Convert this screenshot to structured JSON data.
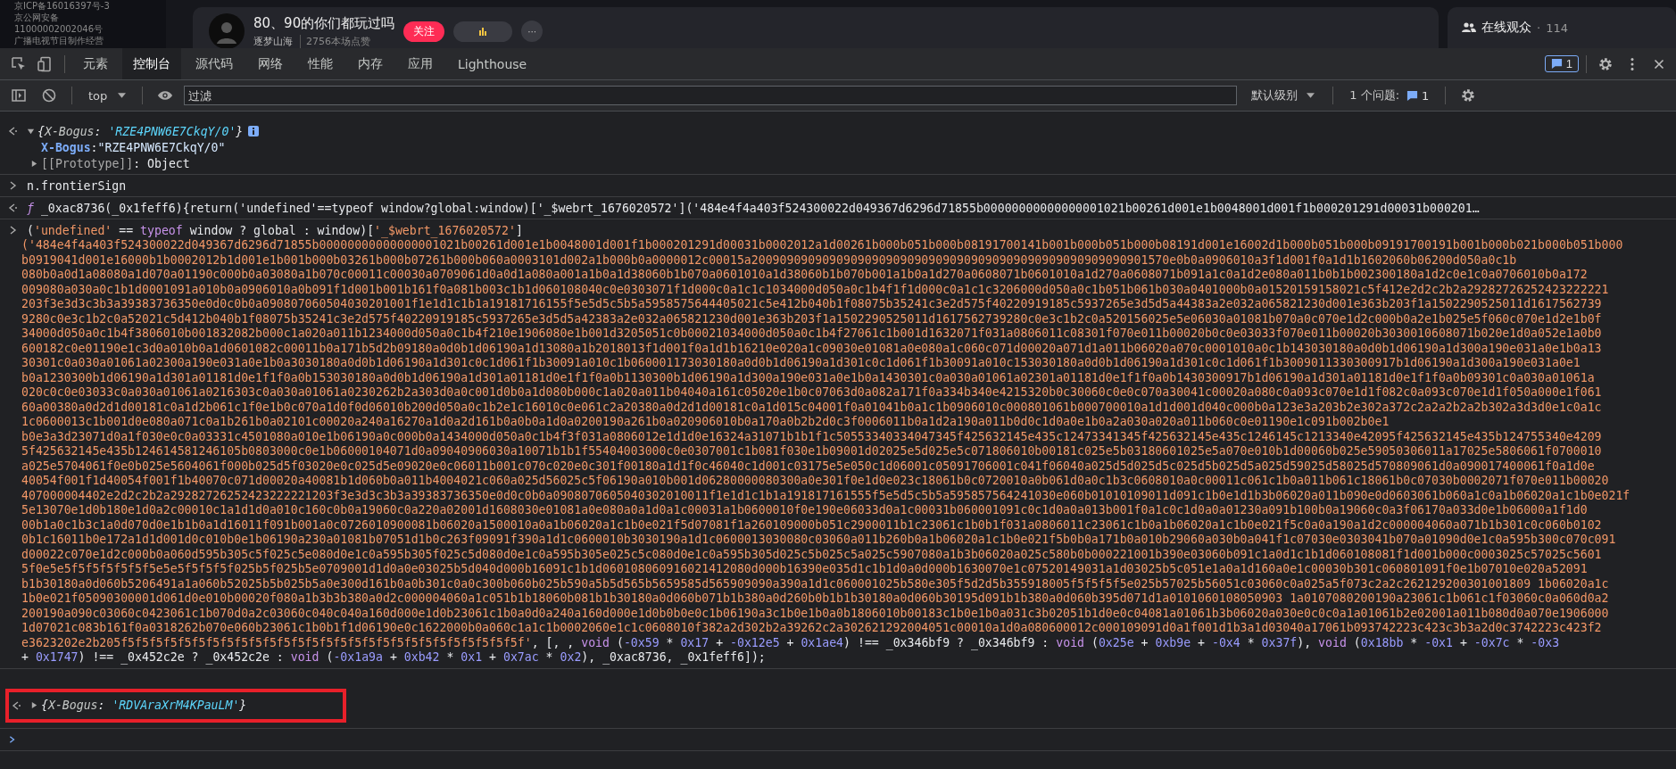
{
  "page": {
    "notices": [
      "京ICP备16016397号-3",
      "京公网安备",
      "11000002002046号",
      "广播电视节目制作经营"
    ],
    "stream": {
      "title": "80、90的你们都玩过吗",
      "streamer": "逐梦山海",
      "likes": "2756本场点赞",
      "follow": "关注",
      "more": "···"
    },
    "audience": {
      "label": "在线观众",
      "separator": "·",
      "count": "114"
    }
  },
  "devtools": {
    "tabs": [
      {
        "label": "元素",
        "selected": false
      },
      {
        "label": "控制台",
        "selected": true
      },
      {
        "label": "源代码",
        "selected": false
      },
      {
        "label": "网络",
        "selected": false
      },
      {
        "label": "性能",
        "selected": false
      },
      {
        "label": "内存",
        "selected": false
      },
      {
        "label": "应用",
        "selected": false
      },
      {
        "label": "Lighthouse",
        "selected": false
      }
    ],
    "message_count": "1",
    "toolbar": {
      "context": "top",
      "filter_placeholder": "过滤",
      "level": "默认级别",
      "issues_label": "1 个问题:",
      "issues_count": "1"
    }
  },
  "console": [
    {
      "kind": "object",
      "expanded": true,
      "summary": [
        {
          "kind": "plain",
          "text": "{"
        },
        {
          "kind": "key",
          "text": "X-Bogus"
        },
        {
          "kind": "plain",
          "text": ": "
        },
        {
          "kind": "val",
          "text": "'RZE4PNW6E7CkqY/0'"
        },
        {
          "kind": "plain",
          "text": "}"
        }
      ],
      "props": [
        {
          "key": "X-Bogus",
          "colon": ":",
          "value": "\"RZE4PNW6E7CkqY/0\""
        }
      ],
      "proto": {
        "key": "[[Prototype]]",
        "colon": ":",
        "value": "Object",
        "expanded": false
      }
    },
    {
      "kind": "input",
      "text": "n.frontierSign"
    },
    {
      "kind": "function",
      "tokens": [
        {
          "kind": "fn",
          "text": "ƒ"
        },
        {
          "kind": "plain",
          "text": " _0xac8736(_0x1feff6){return('undefined'==typeof window?global:window)['_$webrt_1676020572']('484e4f4a403f524300022d049367d6296d71855b00000000000000001021b00261d001e1b0048001d001f1b000201291d00031b000201…"
        }
      ]
    },
    {
      "kind": "expression",
      "header": [
        {
          "kind": "plain",
          "text": "("
        },
        {
          "kind": "str",
          "text": "'undefined'"
        },
        {
          "kind": "plain",
          "text": " == "
        },
        {
          "kind": "kw",
          "text": "typeof"
        },
        {
          "kind": "plain",
          "text": " window ? global : window)["
        },
        {
          "kind": "str",
          "text": "'_$webrt_1676020572'"
        },
        {
          "kind": "plain",
          "text": "]"
        }
      ],
      "lines": [
        "('484e4f4a403f524300022d049367d6296d71855b00000000000000001021b00261d001e1b0048001d001f1b000201291d00031b0002012a1d00261b000b051b000b08191700141b001b000b051b000b08191d001e16002d1b000b051b000b09191700191b001b000b021b000b051b000",
        "b0919041d001e16000b1b0002012b1d001e1b001b000b03261b000b07261b000b060a0003101d002a1b000b0a0000012c00015a20090909090909090909090909090909090909090909090909090901570e0b0a0906010a3f1d001f0a1d1b1602060b06200d050a0c1b",
        "080b0a0d1a08080a1d070a01190c000b0a03080a1b070c00011c00030a0709061d0a0d1a080a001a1b0a1d38060b1b070a0601010a1d38060b1b070b001a1b0a1d270a0608071b0601010a1d270a0608071b091a1c0a1d2e080a011b0b1b002300180a1d2c0e1c0a0706010b0a172",
        "009080a030a0c1b1d0001091a010b0a0906010a0b091f1d001b001b161f0a081b003c1b1d060108040c0e0303071f1d000c0a1c1c1034000d050a0c1b4f1f1d000c0a1c1c3206000d050a0c1b051b061b030a0401000b0a01520159158021c5f412e2d2c2b2a29282726252423222221",
        "203f3e3d3c3b3a39383736350e0d0c0b0a090807060504030201001f1e1d1c1b1a19181716155f5e5d5c5b5a5958575644405021c5e412b040b1f08075b35241c3e2d575f40220919185c5937265e3d5d5a44383a2e032a065821230d001e363b203f1a1502290525011d1617562739",
        "9280c0e3c1b2c0a52021c5d412b040b1f08075b35241c3e2d575f40220919185c5937265e3d5d5a42383a2e032a065821230d001e363b203f1a1502290525011d1617562739280c0e3c1b2c0a520156025e5e06030a01081b070a0c070e1d2c000b0a2e1b025e5f060c070e1d2e1b0f",
        "34000d050a0c1b4f3806010b001832082b000c1a020a011b1234000d050a0c1b4f210e1906080e1b001d3205051c0b00021034000d050a0c1b4f27061c1b001d1632071f031a0806011c08301f070e011b00020b0c0e03033f070e011b00020b3030010608071b020e1d0a052e1a0b0",
        "600182c0e01190e1c3d0a010b0a1d0601082c00011b0a171b5d2b09180a0d0b1d06190a1d13080a1b2018013f1d001f0a1d1b16210e020a1c09030e01081a0e080a1c060c071d00020a071d1a011b06020a070c0001010a0c1b143030180a0d0b1d06190a1d300a190e031a0e1b0a13",
        "30301c0a030a01061a02300a190e031a0e1b0a3030180a0d0b1d06190a1d301c0c1d061f1b30091a010c1b060001173030180a0d0b1d06190a1d301c0c1d061f1b30091a010c153030180a0d0b1d06190a1d301c0c1d061f1b3009011330300917b1d06190a1d300a190e031a0e1",
        "b0a1230300b1d06190a1d301a01181d0e1f1f0a0b153030180a0d0b1d06190a1d301a01181d0e1f1f0a0b1130300b1d06190a1d300a190e031a0e1b0a1430301c0a030a01061a02301a01181d0e1f1f0a0b1430300917b1d06190a1d301a01181d0e1f1f0a0b09301c0a030a01061a",
        "020c0c0e03033c0a030a01061a0216303c0a030a01061a0230262b2a303d0a0c001d0b0a1d080b000c1a020a011b04040a161c05020e1b0c07063d0a082a171f0a334b340e4215320b0c30060c0e0c070a30041c00020a080c0a093c070e1d1f082c0a093c070e1d1f050a000e1f061",
        "60a00380a0d2d1d00181c0a1d2b061c1f0e1b0c070a1d0f0d06010b200d050a0c1b2e1c16010c0e061c2a20380a0d2d1d00181c0a1d015c04001f0a01041b0a1c1b0906010c000801061b000700010a1d1d001d040c000b0a123e3a203b2e302a372c2a2a2b2a2b302a3d3d0e1c0a1c",
        "1c0600013c1b001d0e080a071c0a1b261b0a02101c00020a240a16270a1d0a2d161b0a0b0a1d0a0200190a261b0a020906010b0a170a0b2b2d0c3f0006011b0a1d2a190a011b0d0c1d0a0e1b0a2a030a020a011b060c0e01190e1c091b002b0e1",
        "b0e3a3d23071d0a1f030e0c0a03331c4501080a010e1b06190a0c000b0a1434000d050a0c1b4f3f031a0806012e1d1d0e16324a31071b1b1f1c50553340334047345f425632145e435c12473341345f425632145e435c1246145c1213340e42095f425632145e435b124755340e4209",
        "5f425632145e435b124614581246105b0803000c0e1b06000104071d0a09040906030a10071b1b1f55404003000c0e0307001c1b081f030e1b09001d02025e5d025e5c071806010b00181c025e5b03180601025e5a070e010b1d00060b025e59050306011a17025e5806061f0700010",
        "a025e5704061f0e0b025e5604061f000b025d5f03020e0c025d5e09020e0c06011b001c070c020e0c301f00180a1d1f0c46040c1d001c03175e5e050c1d06001c05091706001c041f06040a025d5d025d5c025d5b025d5a025d59025d58025d570809061d0a090017400061f0a1d0e",
        "40054f001f1d40054f001f1b40070c071d00020a40081b1d060b0a011b4004021c060a025d56025c5f06190a010b001d06280000080300a0e301f0e1d0e023c18061b0c0720010a0b061d0a0c1b3c0608010a0c00011c061c1b0a011b061c18061b0c07030b0002071f070e011b00020",
        "407000004402e2d2c2b2a29282726252423222221203f3e3d3c3b3a39383736350e0d0c0b0a0908070605040302010011f1e1d1c1b1a191817161555f5e5d5c5b5a595857564241030e060b01010109011d091c1b0e1d1b3b06020a011b090e0d0603061b060a1c0a1b06020a1c1b0e021f",
        "5e13070e1d0b180e1d0a2c00010c1a1d1d0a010c160c0b0a19060c0a220a02001d1608030e01081a0e080a0a1d0a1c00031a1b0600010f0e190e06033d0a1c00031b060001091c0c1d0a0a013b001f0a1c0c1d0a0a01230a091b100b0a19060c0a3f06170a033d0e1b06000a1f1d0",
        "00b1a0c1b3c1a0d070d0e1b1b0a1d16011f091b001a0c0726010900081b06020a1500010a0a1b06020a1c1b0e021f5d07081f1a260109000b051c2900011b1c23061c1b0b1f031a0806011c23061c1b0a1b06020a1c1b0e021f5c0a0a190a1d2c000004060a071b1b301c0c060b0102",
        "0b1c16011b0e172a1d1d001d0c010b0e1b06190a230a01081b07051d1b0c263f09091f390a1d1c0600010b3030190a1d1c0600013030080c03060a011b260b0a1b06020a1c1b0e021f5b0b0a171b0a010b29060a030b0a041f1c07030e0303041b070a01090d0e1c0a595b300c070c091",
        "d00022c070e1d2c000b0a060d595b305c5f025c5e080d0e1c0a595b305f025c5d080d0e1c0a595b305e025c5c080d0e1c0a595b305d025c5b025c5a025c5907080a1b3b06020a025c580b0b000221001b390e03060b091c1a0d1c1b1d060108081f1d001b000c0003025c57025c5601",
        "5f0e5e5f5f5f5f5f5f5e5e5f5f5f5f025b5f025b5e0709001d1d0a0e03025b5d040d000b16091c1b1d060108060916021412080d000b16390e035d1c1b1d0a0d000b1630070e1c07520149031a1d03025b5c051e1a0a1d160a0e1c00030b301c060801091f0e1b07010e020a52091",
        "b1b30180a0d060b5206491a1a060b52025b5b025b5a0e300d161b0a0b301c0a0c300b060b025b590a5b5d565b5659585d565909090a390a1d1c060001025b580e305f5d2d5b355918005f5f5f5f5e025b57025b56051c03060c0a025a5f073c2a2c262129200301001809 1b06020a1c",
        "1b0e021f05090300001d061d0e010b00020f080a1b3b3b380a0d2c000004060a1c051b1b18060b081b1b30180a0d060b071b1b380a0d260b0b1b1b30180a0d060b30195d091b1b380a0d060b395d071d1a0101060108050903 1a0107080200190a23061c1b061c1f03060c0a060d0a2",
        "200190a090c03060c0423061c1b070d0a2c03060c040c040a160d000e1d0b23061c1b0a0d0a240a160d000e1d0b0b0e0c1b06190a3c1b0e1b0a0b1806010b00183c1b0e1b0a031c3b02051b1d0e0c04081a01061b3b06020a030e0c0c0a1a01061b2e02001a011b080d0a070e1906000",
        "1d07021c083b161f0a0318262b070e060b23061c1b0b1f1d06190e0c1622000b0a060c1a1c1b0002060e1c1c0608010f382a2d302b2a39262c2a302621292004051c00010a1d0a080600012c000109091d0a1f001d1b3a1d03040a17061b093742223c423c3b3a2d0c3742223c423f2"
      ],
      "tail": [
        [
          {
            "kind": "str",
            "text": "e3623202e2b205f5f5f5f5f5f5f5f5f5f5f5f5f5f5f5f5f5f5f5f5f5f5f5f5f5f5f5f5f'"
          },
          {
            "kind": "plain",
            "text": ", [, , "
          },
          {
            "kind": "kw",
            "text": "void"
          },
          {
            "kind": "plain",
            "text": " ("
          },
          {
            "kind": "num",
            "text": "-0x59"
          },
          {
            "kind": "plain",
            "text": " * "
          },
          {
            "kind": "num",
            "text": "0x17"
          },
          {
            "kind": "plain",
            "text": " + "
          },
          {
            "kind": "num",
            "text": "-0x12e5"
          },
          {
            "kind": "plain",
            "text": " + "
          },
          {
            "kind": "num",
            "text": "0x1ae4"
          },
          {
            "kind": "plain",
            "text": ") !== _0x346bf9 ? _0x346bf9 : "
          },
          {
            "kind": "kw",
            "text": "void"
          },
          {
            "kind": "plain",
            "text": " ("
          },
          {
            "kind": "num",
            "text": "0x25e"
          },
          {
            "kind": "plain",
            "text": " + "
          },
          {
            "kind": "num",
            "text": "0xb9e"
          },
          {
            "kind": "plain",
            "text": " + "
          },
          {
            "kind": "num",
            "text": "-0x4"
          },
          {
            "kind": "plain",
            "text": " * "
          },
          {
            "kind": "num",
            "text": "0x37f"
          },
          {
            "kind": "plain",
            "text": "), "
          },
          {
            "kind": "kw",
            "text": "void"
          },
          {
            "kind": "plain",
            "text": " ("
          },
          {
            "kind": "num",
            "text": "0x18bb"
          },
          {
            "kind": "plain",
            "text": " * "
          },
          {
            "kind": "num",
            "text": "-0x1"
          },
          {
            "kind": "plain",
            "text": " + "
          },
          {
            "kind": "num",
            "text": "-0x7c"
          },
          {
            "kind": "plain",
            "text": " * "
          },
          {
            "kind": "num",
            "text": "-0x3"
          }
        ],
        [
          {
            "kind": "plain",
            "text": "+ "
          },
          {
            "kind": "num",
            "text": "0x1747"
          },
          {
            "kind": "plain",
            "text": ") !== _0x452c2e ? _0x452c2e : "
          },
          {
            "kind": "kw",
            "text": "void"
          },
          {
            "kind": "plain",
            "text": " ("
          },
          {
            "kind": "num",
            "text": "-0x1a9a"
          },
          {
            "kind": "plain",
            "text": " + "
          },
          {
            "kind": "num",
            "text": "0xb42"
          },
          {
            "kind": "plain",
            "text": " * "
          },
          {
            "kind": "num",
            "text": "0x1"
          },
          {
            "kind": "plain",
            "text": " + "
          },
          {
            "kind": "num",
            "text": "0x7ac"
          },
          {
            "kind": "plain",
            "text": " * "
          },
          {
            "kind": "num",
            "text": "0x2"
          },
          {
            "kind": "plain",
            "text": "), _0xac8736, _0x1feff6]);"
          }
        ]
      ]
    },
    {
      "kind": "result",
      "highlighted": true,
      "expanded": false,
      "summary": [
        {
          "kind": "plain",
          "text": "{"
        },
        {
          "kind": "key",
          "text": "X-Bogus"
        },
        {
          "kind": "plain",
          "text": ": "
        },
        {
          "kind": "val",
          "text": "'RDVAraXrM4KPauLM'"
        },
        {
          "kind": "plain",
          "text": "}"
        }
      ]
    },
    {
      "kind": "prompt"
    }
  ]
}
